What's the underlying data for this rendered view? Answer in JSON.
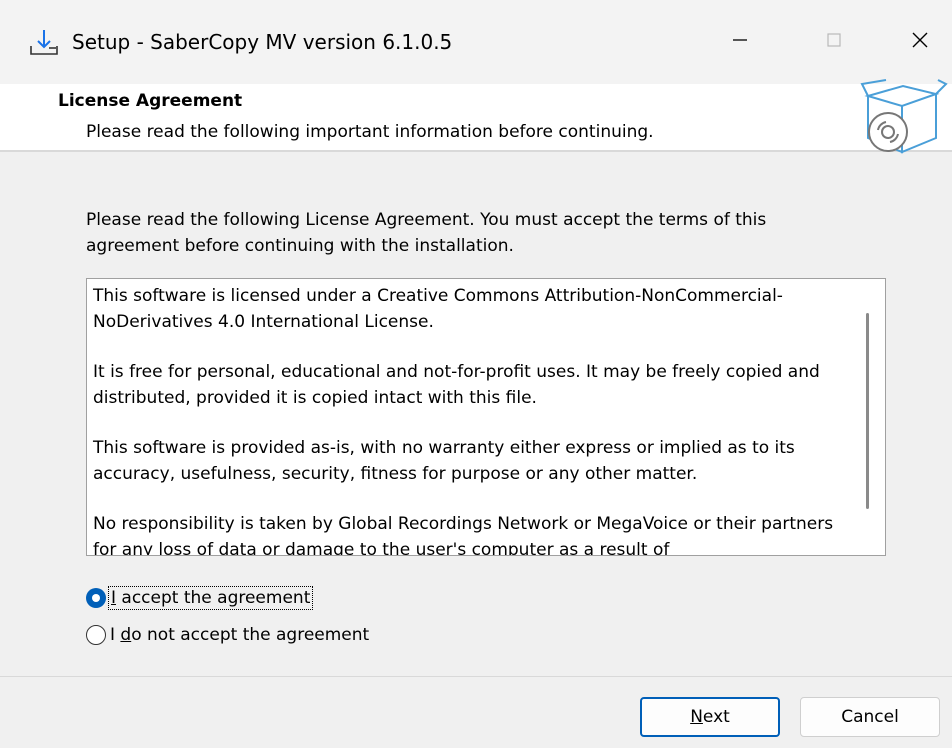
{
  "window": {
    "title": "Setup - SaberCopy MV version 6.1.0.5",
    "icon": "setup-download-icon",
    "controls": [
      "minimize",
      "maximize",
      "close"
    ]
  },
  "header": {
    "title": "License Agreement",
    "subtitle": "Please read the following important information before continuing.",
    "icon": "software-box-icon"
  },
  "intro": "Please read the following License Agreement. You must accept the terms of this agreement before continuing with the installation.",
  "license": {
    "paragraphs": [
      "This software is licensed under a Creative Commons Attribution-NonCommercial-NoDerivatives 4.0 International License.",
      "It is free for personal, educational and not-for-profit uses. It may be freely copied and distributed, provided it is copied intact with this file.",
      "This software is provided as-is, with no warranty either express or implied as to its accuracy, usefulness, security, fitness for purpose or any other matter.",
      "No responsibility is taken by Global Recordings Network or MegaVoice or their partners for any loss of data or damage to the user's computer as a result of"
    ]
  },
  "options": {
    "accept": {
      "pre": "",
      "accel": "I",
      "post": " accept the agreement",
      "selected": true
    },
    "decline": {
      "pre": "I ",
      "accel": "d",
      "post": "o not accept the agreement",
      "selected": false
    }
  },
  "buttons": {
    "next": {
      "accel": "N",
      "rest": "ext"
    },
    "cancel": "Cancel"
  },
  "colors": {
    "accent": "#005fb8",
    "background": "#f0f0f0",
    "panel": "#ffffff"
  }
}
